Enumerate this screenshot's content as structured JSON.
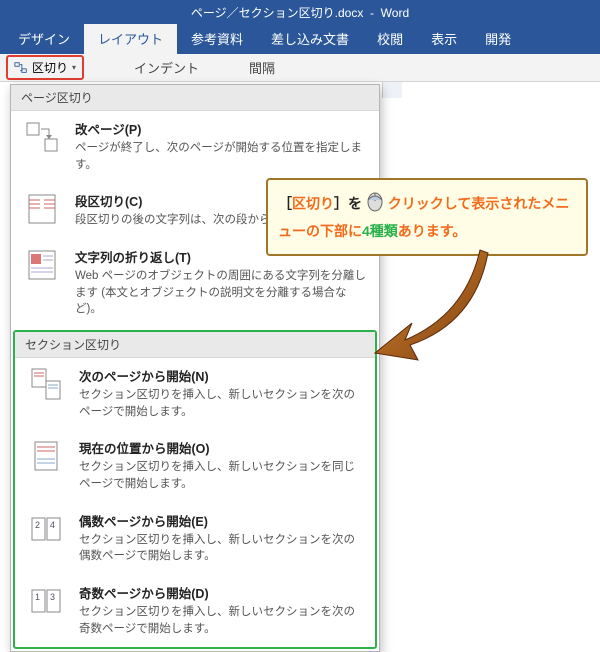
{
  "titlebar": {
    "filename": "ページ／セクション区切り.docx",
    "app": "Word"
  },
  "tabs": {
    "t0": "デザイン",
    "t1": "レイアウト",
    "t2": "参考資料",
    "t3": "差し込み文書",
    "t4": "校閲",
    "t5": "表示",
    "t6": "開発"
  },
  "toolbar": {
    "breaks_label": "区切り",
    "indent_label": "インデント",
    "spacing_label": "間隔"
  },
  "dropdown": {
    "header_page": "ページ区切り",
    "header_section": "セクション区切り",
    "page_items": [
      {
        "title": "改ページ(P)",
        "desc": "ページが終了し、次のページが開始する位置を指定します。"
      },
      {
        "title": "段区切り(C)",
        "desc": "段区切りの後の文字列は、次の段から開始します。"
      },
      {
        "title": "文字列の折り返し(T)",
        "desc": "Web ページのオブジェクトの周囲にある文字列を分離します (本文とオブジェクトの説明文を分離する場合など)。"
      }
    ],
    "section_items": [
      {
        "title": "次のページから開始(N)",
        "desc": "セクション区切りを挿入し、新しいセクションを次のページで開始します。"
      },
      {
        "title": "現在の位置から開始(O)",
        "desc": "セクション区切りを挿入し、新しいセクションを同じページで開始します。"
      },
      {
        "title": "偶数ページから開始(E)",
        "desc": "セクション区切りを挿入し、新しいセクションを次の偶数ページで開始します。"
      },
      {
        "title": "奇数ページから開始(D)",
        "desc": "セクション区切りを挿入し、新しいセクションを次の奇数ページで開始します。"
      }
    ]
  },
  "callout": {
    "seg1": "［",
    "seg2": "区切り",
    "seg3": "］を ",
    "seg4": "クリックして表示されたメニューの下部に",
    "seg5": "4種類",
    "seg6": "あります。"
  }
}
